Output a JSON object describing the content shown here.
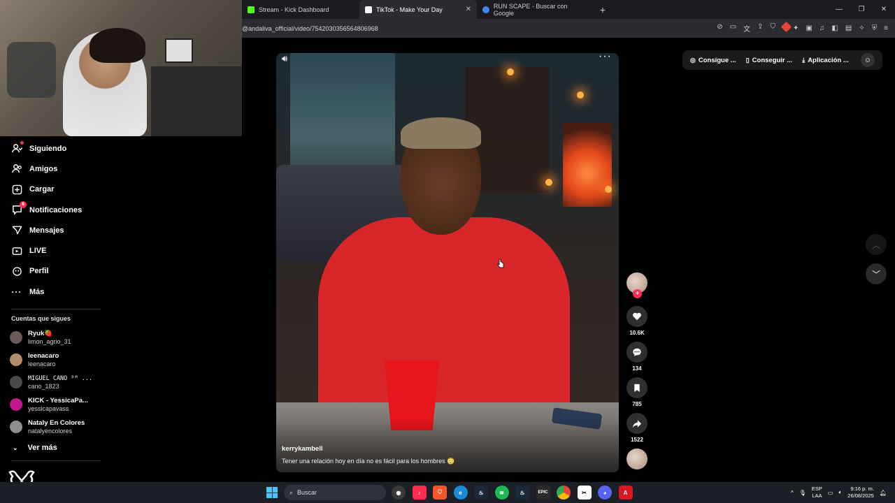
{
  "browser": {
    "tabs": [
      {
        "title": "Stream - Kick Dashboard",
        "active": false,
        "favicon_color": "#53fc18"
      },
      {
        "title": "TikTok - Make Your Day",
        "active": true,
        "favicon_color": "#ffffff"
      },
      {
        "title": "RUN SCAPE - Buscar con Google",
        "active": false,
        "favicon_color": "#4285f4"
      }
    ],
    "new_tab": "+",
    "url": "@andaliva_official/video/7542030356564806968"
  },
  "sidebar": {
    "items": [
      {
        "label": "Siguiendo",
        "icon": "following-icon"
      },
      {
        "label": "Amigos",
        "icon": "friends-icon"
      },
      {
        "label": "Cargar",
        "icon": "upload-icon"
      },
      {
        "label": "Notificaciones",
        "icon": "notifications-icon",
        "badge": "8"
      },
      {
        "label": "Mensajes",
        "icon": "messages-icon"
      },
      {
        "label": "LIVE",
        "icon": "live-icon"
      },
      {
        "label": "Perfil",
        "icon": "profile-icon"
      },
      {
        "label": "Más",
        "icon": "more-icon"
      }
    ],
    "following_title": "Cuentas que sigues",
    "accounts": [
      {
        "name": "Ryuk🍓",
        "handle": "limon_agrio_31",
        "avatar_color": "#6b5a58"
      },
      {
        "name": "leenacaro",
        "handle": "leenacaro",
        "avatar_color": "#b38b6d"
      },
      {
        "name": "MIGUEL CANO ᴰᴹ ...",
        "handle": "cano_1823",
        "avatar_color": "#4a4a4a"
      },
      {
        "name": "KICK - YessicaPa...",
        "handle": "yessicapavass",
        "avatar_color": "#c2188b"
      },
      {
        "name": "Nataly En Colores",
        "handle": "natalyencolores",
        "avatar_color": "#8e8e8e"
      }
    ],
    "see_more": "Ver más"
  },
  "video": {
    "author": "kerrykambell",
    "caption": "Tener una relación hoy en día no es fácil para los hombres 😳"
  },
  "actions": {
    "likes": "10.6K",
    "comments": "134",
    "saves": "785",
    "shares": "1522"
  },
  "top_pills": [
    {
      "label": "Consigue ...",
      "icon": "coin-icon"
    },
    {
      "label": "Conseguir ...",
      "icon": "phone-icon"
    },
    {
      "label": "Aplicación ...",
      "icon": "download-icon"
    }
  ],
  "taskbar": {
    "search_placeholder": "Buscar",
    "lang_line1": "ESP",
    "lang_line2": "LAA",
    "time": "9:16 p. m.",
    "date": "26/08/2025"
  },
  "colors": {
    "accent": "#fe2c55",
    "background": "#000000"
  }
}
